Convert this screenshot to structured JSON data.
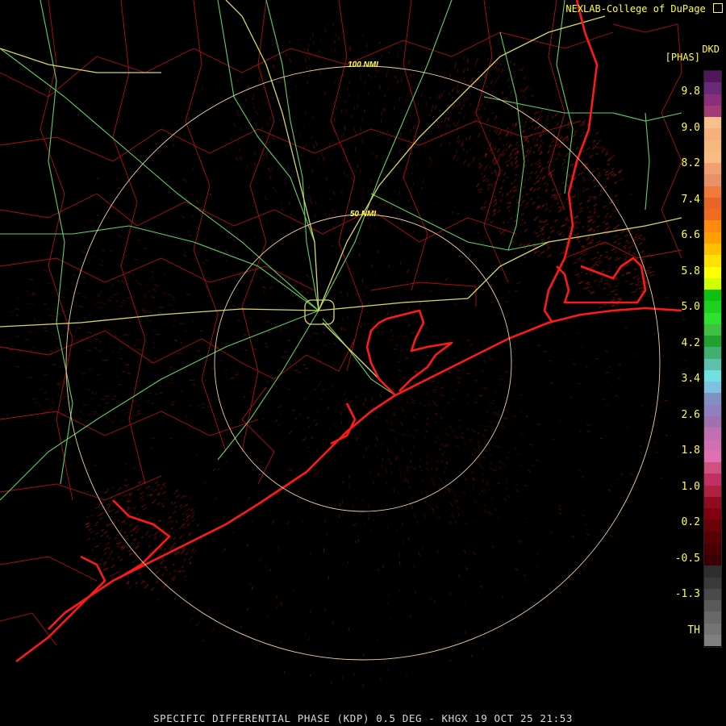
{
  "header": {
    "credit": "NEXLAB-College of DuPage",
    "credit_icon": "external-link-icon"
  },
  "legend": {
    "product_code": "DKD",
    "units": "[PHAS]",
    "labels": [
      "9.8",
      "9.0",
      "8.2",
      "7.4",
      "6.6",
      "5.8",
      "5.0",
      "4.2",
      "3.4",
      "2.6",
      "1.8",
      "1.0",
      "0.2",
      "-0.5",
      "-1.3",
      "TH"
    ],
    "colors": [
      "#50185a",
      "#6a2a7a",
      "#8a2f7a",
      "#a33c76",
      "#f7c08a",
      "#f5b07e",
      "#f7b880",
      "#f8ba86",
      "#f0a070",
      "#e89068",
      "#f07a3a",
      "#e8652a",
      "#f06a20",
      "#ff8a10",
      "#ffa000",
      "#ffc000",
      "#ffe000",
      "#ffff00",
      "#d0ff00",
      "#10c010",
      "#20d020",
      "#30e030",
      "#40c040",
      "#20a030",
      "#40b070",
      "#60c0b0",
      "#70e0e0",
      "#80c0e0",
      "#8090c0",
      "#9080c0",
      "#a070b0",
      "#c070b0",
      "#d070b0",
      "#e070b0",
      "#d05080",
      "#c03060",
      "#b02040",
      "#900a20",
      "#800010",
      "#6a0008",
      "#580005",
      "#480005",
      "#3c0004",
      "#2e2e2e",
      "#3a3a3a",
      "#4a4a4a",
      "#5a5a5a",
      "#686868",
      "#747474",
      "#808080"
    ]
  },
  "rings": [
    {
      "label": "100 NMI",
      "radius_nmi": 100
    },
    {
      "label": "50 NMI",
      "radius_nmi": 50
    }
  ],
  "footer": {
    "text": "SPECIFIC DIFFERENTIAL PHASE (KDP) 0.5 DEG - KHGX 19 OCT 25 21:53"
  },
  "map_colors": {
    "coastline": "#ff1a1a",
    "county": "#b01010",
    "highway": "#60d060",
    "interstate": "#d8d860",
    "ring": "#f0d0a0",
    "echo": "#8a1010"
  }
}
